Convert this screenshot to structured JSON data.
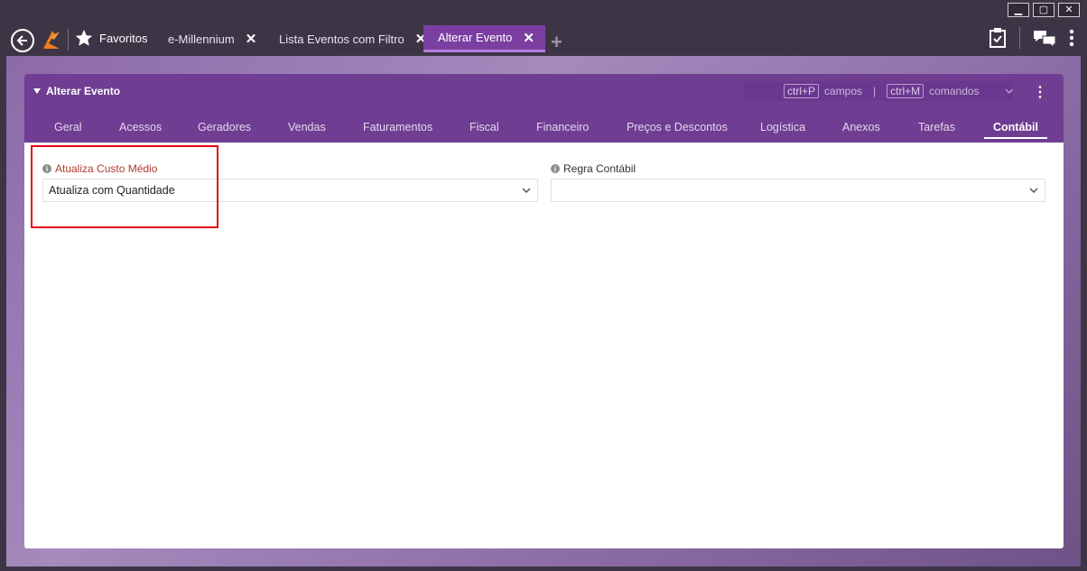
{
  "window": {
    "controls": [
      "minimize",
      "maximize",
      "close"
    ]
  },
  "topbar": {
    "favorites_label": "Favoritos",
    "tabs": [
      {
        "label": "e-Millennium",
        "active": false
      },
      {
        "label": "Lista Eventos com Filtro",
        "active": false
      },
      {
        "label": "Alterar Evento",
        "active": true
      }
    ],
    "icons": [
      "back-arrow-icon",
      "logo-icon",
      "star-icon",
      "close-icon",
      "plus-icon",
      "clipboard-check-icon",
      "chat-icon",
      "more-vertical-icon"
    ]
  },
  "panel": {
    "title": "Alterar Evento",
    "shortcuts": {
      "campos_key": "ctrl+P",
      "campos_label": "campos",
      "separator": "|",
      "comandos_key": "ctrl+M",
      "comandos_label": "comandos"
    },
    "tabs": [
      "Geral",
      "Acessos",
      "Geradores",
      "Vendas",
      "Faturamentos",
      "Fiscal",
      "Financeiro",
      "Preços e Descontos",
      "Logística",
      "Anexos",
      "Tarefas",
      "Contábil"
    ],
    "active_tab": "Contábil"
  },
  "form": {
    "atualiza_custo": {
      "label": "Atualiza Custo Médio",
      "value": "Atualiza com Quantidade"
    },
    "regra_contabil": {
      "label": "Regra Contábil",
      "value": ""
    }
  },
  "colors": {
    "header_purple": "#6f3d92",
    "active_tab_purple": "#7a3fa0",
    "required_label": "#b03a2e",
    "highlight_red": "#e30613"
  }
}
